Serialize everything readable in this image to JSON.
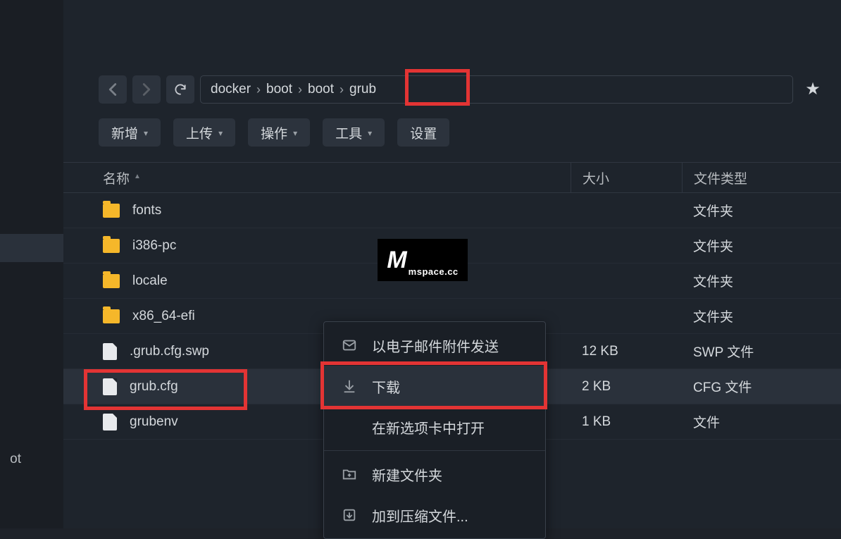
{
  "sidebar": {
    "text": "ot"
  },
  "breadcrumb": [
    "docker",
    "boot",
    "boot",
    "grub"
  ],
  "nav": {
    "sort_label": "名称"
  },
  "actions": {
    "new": "新增",
    "upload": "上传",
    "operate": "操作",
    "tool": "工具",
    "settings": "设置"
  },
  "columns": {
    "name": "名称",
    "size": "大小",
    "type": "文件类型"
  },
  "rows": [
    {
      "icon": "folder",
      "name": "fonts",
      "size": "",
      "type": "文件夹"
    },
    {
      "icon": "folder",
      "name": "i386-pc",
      "size": "",
      "type": "文件夹"
    },
    {
      "icon": "folder",
      "name": "locale",
      "size": "",
      "type": "文件夹"
    },
    {
      "icon": "folder",
      "name": "x86_64-efi",
      "size": "",
      "type": "文件夹"
    },
    {
      "icon": "file",
      "name": ".grub.cfg.swp",
      "size": "12 KB",
      "type": "SWP 文件"
    },
    {
      "icon": "file",
      "name": "grub.cfg",
      "size": "2 KB",
      "type": "CFG 文件",
      "selected": true
    },
    {
      "icon": "file",
      "name": "grubenv",
      "size": "1 KB",
      "type": "文件"
    }
  ],
  "menu": {
    "email": "以电子邮件附件发送",
    "download": "下载",
    "newtab": "在新选项卡中打开",
    "newfolder": "新建文件夹",
    "archive": "加到压缩文件..."
  },
  "watermark": {
    "m": "M",
    "text": "mspace.cc"
  }
}
